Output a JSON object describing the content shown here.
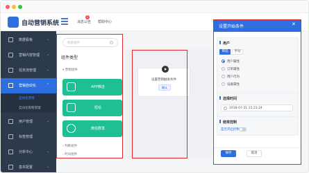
{
  "colors": {
    "accent": "#2e6fe0",
    "sidebar_bg": "#2d3a4b",
    "card_green": "#1fbf94",
    "highlight_red": "#e8262b"
  },
  "app": {
    "name": "自动营销系统"
  },
  "topbar": {
    "messages": "消息公告",
    "badge": "1",
    "help": "帮助中心"
  },
  "sidebar": {
    "items": [
      {
        "label": "数据看板",
        "icon": "dashboard-icon"
      },
      {
        "label": "营销内容管理",
        "icon": "content-icon"
      },
      {
        "label": "任务流管理",
        "icon": "task-icon"
      },
      {
        "label": "营销自动化",
        "icon": "automation-icon"
      },
      {
        "label": "用户管理",
        "icon": "user-icon"
      },
      {
        "label": "标签管理",
        "icon": "tag-icon"
      },
      {
        "label": "分析中心",
        "icon": "analysis-icon"
      },
      {
        "label": "基本配置",
        "icon": "settings-icon"
      }
    ],
    "subitems": [
      {
        "label": "自动化营销"
      },
      {
        "label": "自动化策略管理"
      }
    ]
  },
  "components": {
    "search_placeholder": "搜索组件",
    "title": "组件类型",
    "group_marketing": "营销组件",
    "cards": [
      {
        "label": "APP推送",
        "icon": "app-push-icon"
      },
      {
        "label": "短信",
        "icon": "sms-icon"
      },
      {
        "label": "微信群发",
        "icon": "wechat-icon"
      }
    ],
    "group_judge": "判断组件",
    "group_time": "时间组件"
  },
  "canvas": {
    "node_text": "设置营销触发条件",
    "node_button": "确认"
  },
  "drawer": {
    "title": "设置开始条件",
    "section_user": "用户",
    "tabs": [
      "筛选",
      "手动"
    ],
    "radios": [
      "用户属性",
      "订单属性",
      "用户行为",
      "设备属性"
    ],
    "section_time": "选择时间",
    "datetime": "2018-07-31 15:23:24",
    "section_flow": "结束控制",
    "toggle_label": "是否开启控制",
    "ok": "保存",
    "cancel": "取消"
  }
}
